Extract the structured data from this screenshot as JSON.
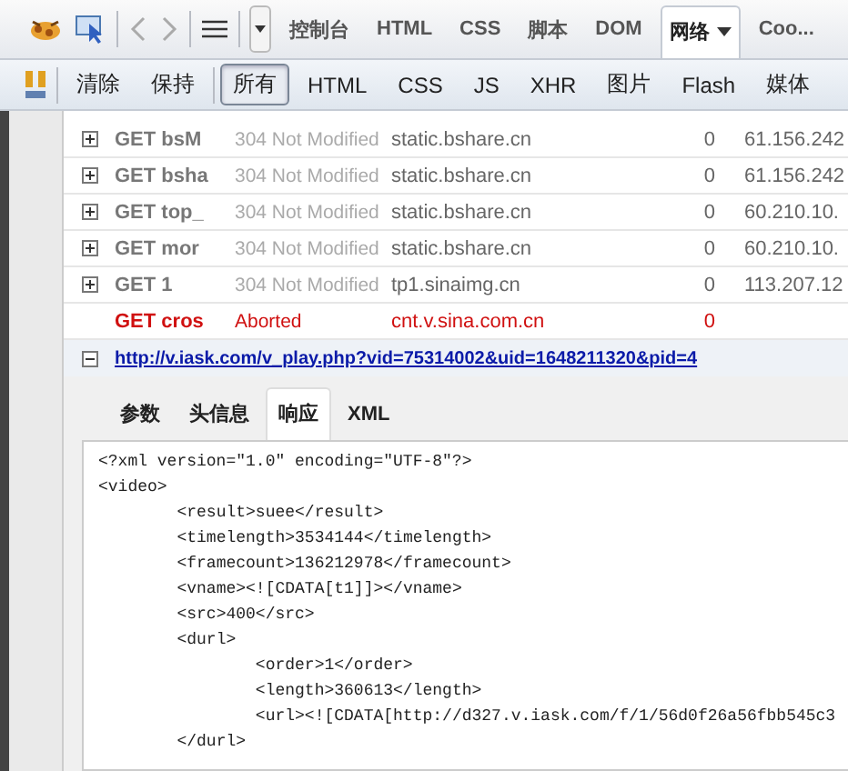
{
  "toolbar": {
    "tabs": [
      {
        "label": "控制台",
        "selected": false
      },
      {
        "label": "HTML",
        "selected": false
      },
      {
        "label": "CSS",
        "selected": false
      },
      {
        "label": "脚本",
        "selected": false
      },
      {
        "label": "DOM",
        "selected": false
      },
      {
        "label": "网络",
        "selected": true,
        "dropdown": true
      },
      {
        "label": "Coo...",
        "selected": false
      }
    ]
  },
  "filters": {
    "actions": [
      "清除",
      "保持"
    ],
    "types": [
      {
        "label": "所有",
        "selected": true
      },
      {
        "label": "HTML",
        "selected": false
      },
      {
        "label": "CSS",
        "selected": false
      },
      {
        "label": "JS",
        "selected": false
      },
      {
        "label": "XHR",
        "selected": false
      },
      {
        "label": "图片",
        "selected": false
      },
      {
        "label": "Flash",
        "selected": false
      },
      {
        "label": "媒体",
        "selected": false
      }
    ]
  },
  "requests": [
    {
      "name": "GET bsM",
      "status": "304 Not Modified",
      "domain": "static.bshare.cn",
      "size": "0",
      "ip": "61.156.242",
      "error": false
    },
    {
      "name": "GET bsha",
      "status": "304 Not Modified",
      "domain": "static.bshare.cn",
      "size": "0",
      "ip": "61.156.242",
      "error": false
    },
    {
      "name": "GET top_",
      "status": "304 Not Modified",
      "domain": "static.bshare.cn",
      "size": "0",
      "ip": "60.210.10.",
      "error": false
    },
    {
      "name": "GET mor",
      "status": "304 Not Modified",
      "domain": "static.bshare.cn",
      "size": "0",
      "ip": "60.210.10.",
      "error": false
    },
    {
      "name": "GET 1",
      "status": "304 Not Modified",
      "domain": "tp1.sinaimg.cn",
      "size": "0",
      "ip": "113.207.12",
      "error": false
    },
    {
      "name": "GET cros",
      "status": "Aborted",
      "domain": "cnt.v.sina.com.cn",
      "size": "0",
      "error": true
    }
  ],
  "expanded_request": {
    "url": "http://v.iask.com/v_play.php?vid=75314002&uid=1648211320&pid=4",
    "expanded": true,
    "tabs": [
      {
        "label": "参数",
        "selected": false
      },
      {
        "label": "头信息",
        "selected": false
      },
      {
        "label": "响应",
        "selected": true
      },
      {
        "label": "XML",
        "selected": false
      }
    ],
    "response_lines": [
      "<?xml version=\"1.0\" encoding=\"UTF-8\"?>",
      "<video>",
      "\t<result>suee</result>",
      "\t<timelength>3534144</timelength>",
      "\t<framecount>136212978</framecount>",
      "\t<vname><![CDATA[t1]]></vname>",
      "\t<src>400</src>",
      "\t<durl>",
      "\t\t<order>1</order>",
      "\t\t<length>360613</length>",
      "\t\t<url><![CDATA[http://d327.v.iask.com/f/1/56d0f26a56fbb545c3",
      "\t</durl>"
    ]
  }
}
